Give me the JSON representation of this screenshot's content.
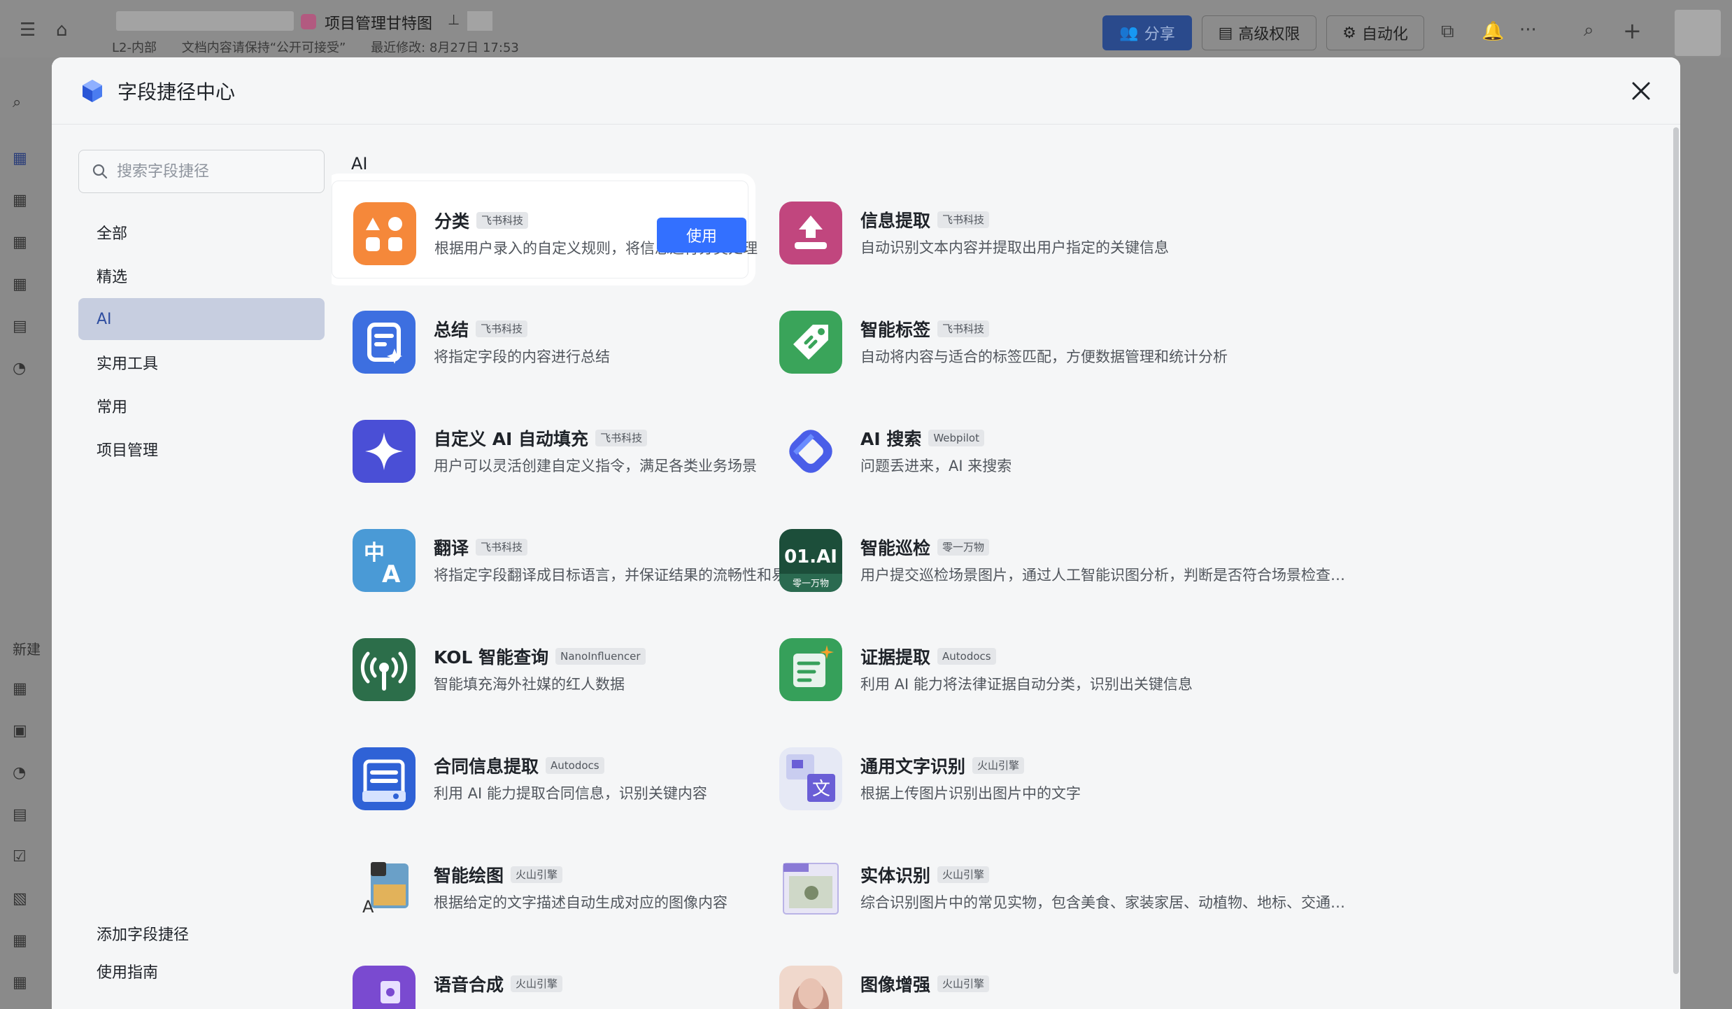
{
  "topbar": {
    "doc_title": "项目管理甘特图",
    "meta": [
      "L2-内部",
      "文档内容请保持“公开可接受”",
      "最近修改: 8月27日 17:53"
    ],
    "share_label": "分享",
    "permission_label": "高级权限",
    "automation_label": "自动化"
  },
  "leftbar": {
    "new_label": "新建"
  },
  "modal": {
    "title": "字段捷径中心",
    "search_placeholder": "搜索字段捷径",
    "nav": [
      "全部",
      "精选",
      "AI",
      "实用工具",
      "常用",
      "项目管理"
    ],
    "active_nav": "AI",
    "footer": [
      "添加字段捷径",
      "使用指南"
    ],
    "section_title": "AI",
    "use_label": "使用"
  },
  "cards": [
    {
      "name": "分类",
      "tag": "飞书科技",
      "desc": "根据用户录入的自定义规则，将信息进行分类处理",
      "icon": "classify-icon",
      "color": "#f5883a"
    },
    {
      "name": "信息提取",
      "tag": "飞书科技",
      "desc": "自动识别文本内容并提取出用户指定的关键信息",
      "icon": "extract-icon",
      "color": "#c1467e"
    },
    {
      "name": "总结",
      "tag": "飞书科技",
      "desc": "将指定字段的内容进行总结",
      "icon": "summary-icon",
      "color": "#3d6fe0"
    },
    {
      "name": "智能标签",
      "tag": "飞书科技",
      "desc": "自动将内容与适合的标签匹配，方便数据管理和统计分析",
      "icon": "tag-icon",
      "color": "#3aa45a"
    },
    {
      "name": "自定义 AI 自动填充",
      "tag": "飞书科技",
      "desc": "用户可以灵活创建自定义指令，满足各类业务场景",
      "icon": "sparkle-icon",
      "color": "#4a4fd6"
    },
    {
      "name": "AI 搜索",
      "tag": "Webpilot",
      "desc": "问题丢进来，AI 来搜索",
      "icon": "ai-search-icon",
      "color": "#4a5ee8"
    },
    {
      "name": "翻译",
      "tag": "飞书科技",
      "desc": "将指定字段翻译成目标语言，并保证结果的流畅性和易读性",
      "icon": "translate-icon",
      "color": "#4a9ad6"
    },
    {
      "name": "智能巡检",
      "tag": "零一万物",
      "desc": "用户提交巡检场景图片，通过人工智能识图分析，判断是否符合场景检查标准",
      "icon": "01ai-icon",
      "color": "#1c4e3a"
    },
    {
      "name": "KOL 智能查询",
      "tag": "NanoInfluencer",
      "desc": "智能填充海外社媒的红人数据",
      "icon": "broadcast-icon",
      "color": "#2c6e4a"
    },
    {
      "name": "证据提取",
      "tag": "Autodocs",
      "desc": "利用 AI 能力将法律证据自动分类，识别出关键信息",
      "icon": "evidence-icon",
      "color": "#36a05a"
    },
    {
      "name": "合同信息提取",
      "tag": "Autodocs",
      "desc": "利用 AI 能力提取合同信息，识别关键内容",
      "icon": "contract-icon",
      "color": "#2f62d6"
    },
    {
      "name": "通用文字识别",
      "tag": "火山引擎",
      "desc": "根据上传图片识别出图片中的文字",
      "icon": "ocr-icon",
      "color": "#6a5ed6"
    },
    {
      "name": "智能绘图",
      "tag": "火山引擎",
      "desc": "根据给定的文字描述自动生成对应的图像内容",
      "icon": "draw-icon",
      "color": "#6aa0c8"
    },
    {
      "name": "实体识别",
      "tag": "火山引擎",
      "desc": "综合识别图片中的常见实物，包含美食、家装家居、动植物、地标、交通工具等",
      "icon": "entity-icon",
      "color": "#8a7ad6"
    },
    {
      "name": "语音合成",
      "tag": "火山引擎",
      "desc": "",
      "icon": "tts-icon",
      "color": "#7a4ad0"
    },
    {
      "name": "图像增强",
      "tag": "火山引擎",
      "desc": "",
      "icon": "enhance-icon",
      "color": "#c08a7a"
    }
  ]
}
